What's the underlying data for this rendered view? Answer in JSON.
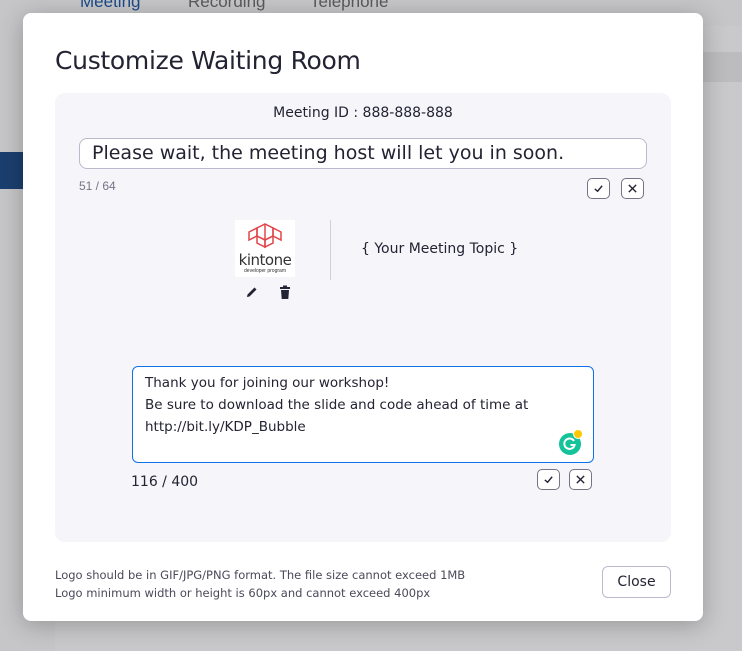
{
  "background": {
    "tabs": [
      "Meeting",
      "Recording",
      "Telephone"
    ]
  },
  "dialog": {
    "title": "Customize Waiting Room",
    "meeting_id": "Meeting ID : 888-888-888",
    "title_field": {
      "value": "Please wait, the meeting host will let you in soon.",
      "counter": "51 / 64"
    },
    "logo": {
      "brand": "kintone",
      "tagline": "developer program",
      "edit_icon": "pencil-icon",
      "delete_icon": "trash-icon"
    },
    "topic": "{ Your Meeting Topic }",
    "description_field": {
      "lines": [
        "Thank you for joining our workshop!",
        "Be sure to download the slide and code ahead of time at",
        "http://bit.ly/KDP_Bubble"
      ],
      "counter": "116 / 400"
    },
    "notes": [
      "Logo should be in GIF/JPG/PNG format. The file size cannot exceed 1MB",
      "Logo minimum width or height is 60px and cannot exceed 400px"
    ],
    "close_label": "Close"
  },
  "colors": {
    "accent": "#0e72ed",
    "panel_bg": "#f5f5fa",
    "logo_red": "#e0474c",
    "grammarly": "#15c39a"
  }
}
